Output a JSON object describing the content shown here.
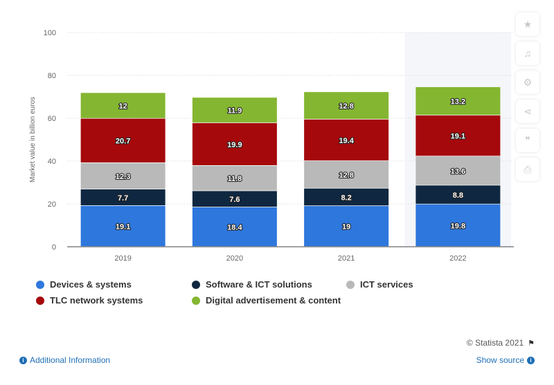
{
  "chart_data": {
    "type": "bar",
    "stacked": true,
    "title": "",
    "xlabel": "",
    "ylabel": "Market value in billion euros",
    "ylim": [
      0,
      100
    ],
    "yticks": [
      0,
      20,
      40,
      60,
      80,
      100
    ],
    "grid": true,
    "legend_position": "bottom",
    "categories": [
      "2019",
      "2020",
      "2021",
      "2022"
    ],
    "series": [
      {
        "name": "Devices & systems",
        "color": "#2e77dd",
        "values": [
          19.1,
          18.4,
          19,
          19.8
        ]
      },
      {
        "name": "Software & ICT solutions",
        "color": "#0f2740",
        "values": [
          7.7,
          7.6,
          8.2,
          8.8
        ]
      },
      {
        "name": "ICT services",
        "color": "#b9b9b9",
        "values": [
          12.3,
          11.8,
          12.8,
          13.6
        ]
      },
      {
        "name": "TLC network systems",
        "color": "#a5090c",
        "values": [
          20.7,
          19.9,
          19.4,
          19.1
        ]
      },
      {
        "name": "Digital advertisement & content",
        "color": "#84b631",
        "values": [
          12,
          11.9,
          12.8,
          13.2
        ]
      }
    ],
    "highlight_category": "2022",
    "highlight_color": "#f4f6f9"
  },
  "toolbar": {
    "icons": [
      "star-icon",
      "bell-icon",
      "gear-icon",
      "share-icon",
      "quote-icon",
      "print-icon"
    ]
  },
  "footer": {
    "copyright": "© Statista 2021",
    "additional_info": "Additional Information",
    "show_source": "Show source"
  }
}
